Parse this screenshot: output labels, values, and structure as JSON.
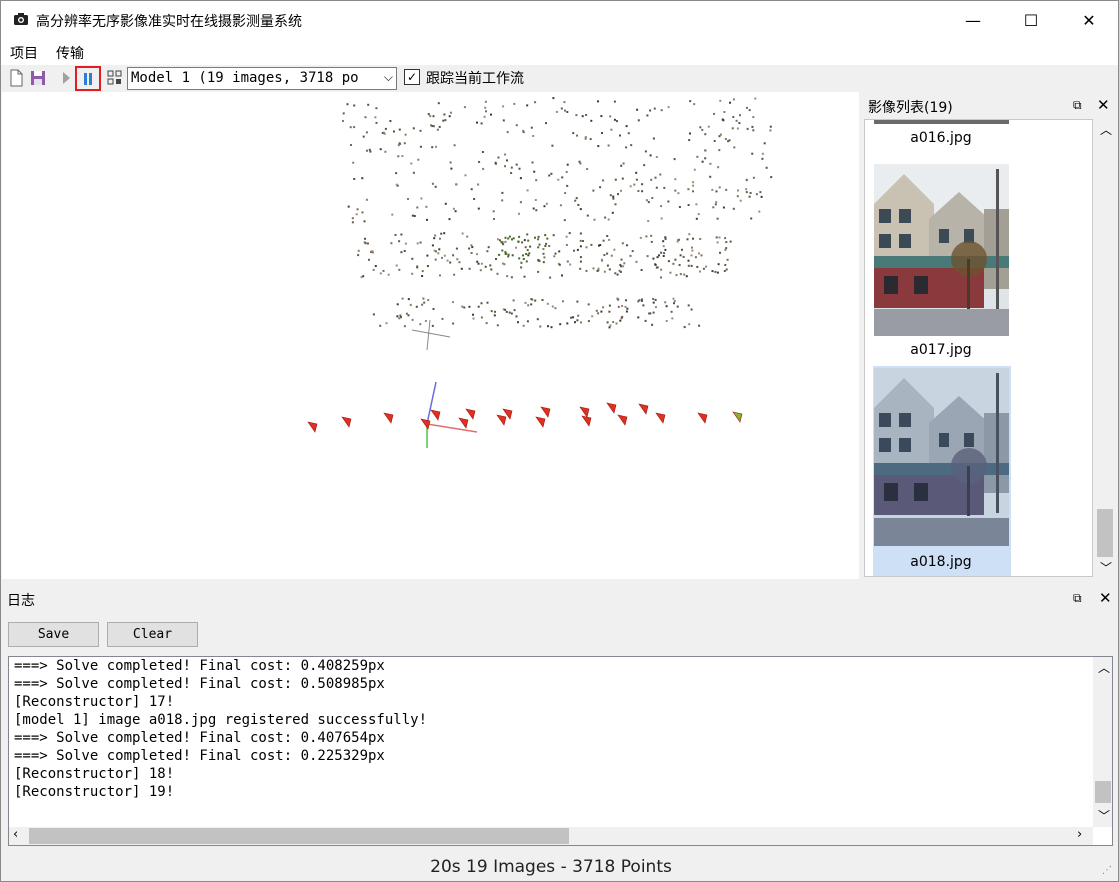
{
  "window": {
    "title": "高分辨率无序影像准实时在线摄影测量系统",
    "minimize": "—",
    "maximize": "☐",
    "close": "✕"
  },
  "menu": {
    "items": [
      "项目",
      "传输"
    ]
  },
  "toolbar": {
    "model_select": "Model 1 (19 images, 3718 po",
    "track_label": "跟踪当前工作流",
    "track_checked": "✓"
  },
  "image_list": {
    "title": "影像列表(19)",
    "items": [
      {
        "caption": "a016.jpg"
      },
      {
        "caption": "a017.jpg"
      },
      {
        "caption": "a018.jpg",
        "selected": true
      }
    ]
  },
  "log": {
    "title": "日志",
    "save_label": "Save",
    "clear_label": "Clear",
    "lines": [
      "===> Solve completed! Final cost: 0.408259px",
      "===> Solve completed! Final cost: 0.508985px",
      "[Reconstructor] 17!",
      "[model 1] image a018.jpg registered successfully!",
      "===> Solve completed! Final cost: 0.407654px",
      "===> Solve completed! Final cost: 0.225329px",
      "[Reconstructor] 18!",
      "[Reconstructor] 19!"
    ]
  },
  "status": {
    "text": "20s  19 Images - 3718 Points"
  },
  "colors": {
    "accent_highlight": "#e02020",
    "camera_marker": "#e03020",
    "selected_item": "#cde0f5"
  }
}
